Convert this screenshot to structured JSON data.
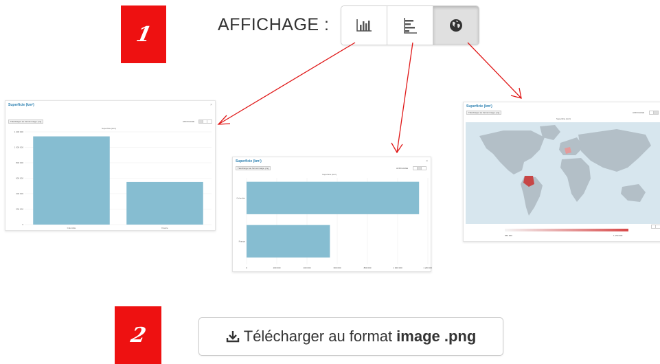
{
  "annotations": {
    "step1": "1",
    "step2": "2"
  },
  "display": {
    "label": "AFFICHAGE :",
    "buttons": [
      {
        "icon": "vertical-bar-chart-icon",
        "selected": false
      },
      {
        "icon": "horizontal-bar-chart-icon",
        "selected": false
      },
      {
        "icon": "globe-icon",
        "selected": true
      }
    ]
  },
  "download": {
    "label": "Télécharger au format",
    "bold": "image .png"
  },
  "previews": {
    "vertical": {
      "title": "Superficie (km²)",
      "close": "×",
      "download": "Télécharger au format image .png",
      "affichage": "AFFICHAGE",
      "subtitle": "Superficie (km²)",
      "chart_data": {
        "type": "bar",
        "categories": [
          "Colombie",
          "France"
        ],
        "values": [
          1141748,
          551695
        ],
        "ylim": [
          0,
          1200000
        ],
        "ytick_labels": [
          "0",
          "200 000",
          "400 000",
          "600 000",
          "800 000",
          "1 000 000",
          "1 200 000"
        ]
      }
    },
    "horizontal": {
      "title": "Superficie (km²)",
      "close": "×",
      "download": "Télécharger au format image .png",
      "affichage": "AFFICHAGE",
      "subtitle": "Superficie (km²)",
      "chart_data": {
        "type": "bar",
        "orientation": "horizontal",
        "categories": [
          "Colombie",
          "France"
        ],
        "values": [
          1141748,
          551695
        ],
        "xlim": [
          0,
          1200000
        ],
        "xtick_labels": [
          "0",
          "200 000",
          "400 000",
          "600 000",
          "800 000",
          "1 000 000",
          "1 200 000"
        ]
      }
    },
    "map": {
      "title": "Superficie (km²)",
      "download": "Télécharger au format image .png",
      "affichage": "AFFICHAGE",
      "subtitle": "Superficie (km²)",
      "legend_min": "550 000",
      "legend_max": "1 150 000",
      "colors": {
        "ocean": "#d7e6ee",
        "land": "#b3bfc7",
        "colombia": "#c74646",
        "france": "#e49a9a"
      }
    }
  },
  "colors": {
    "accent": "#ee1111",
    "bar": "#86bdd1",
    "title": "#2a7fb0"
  }
}
